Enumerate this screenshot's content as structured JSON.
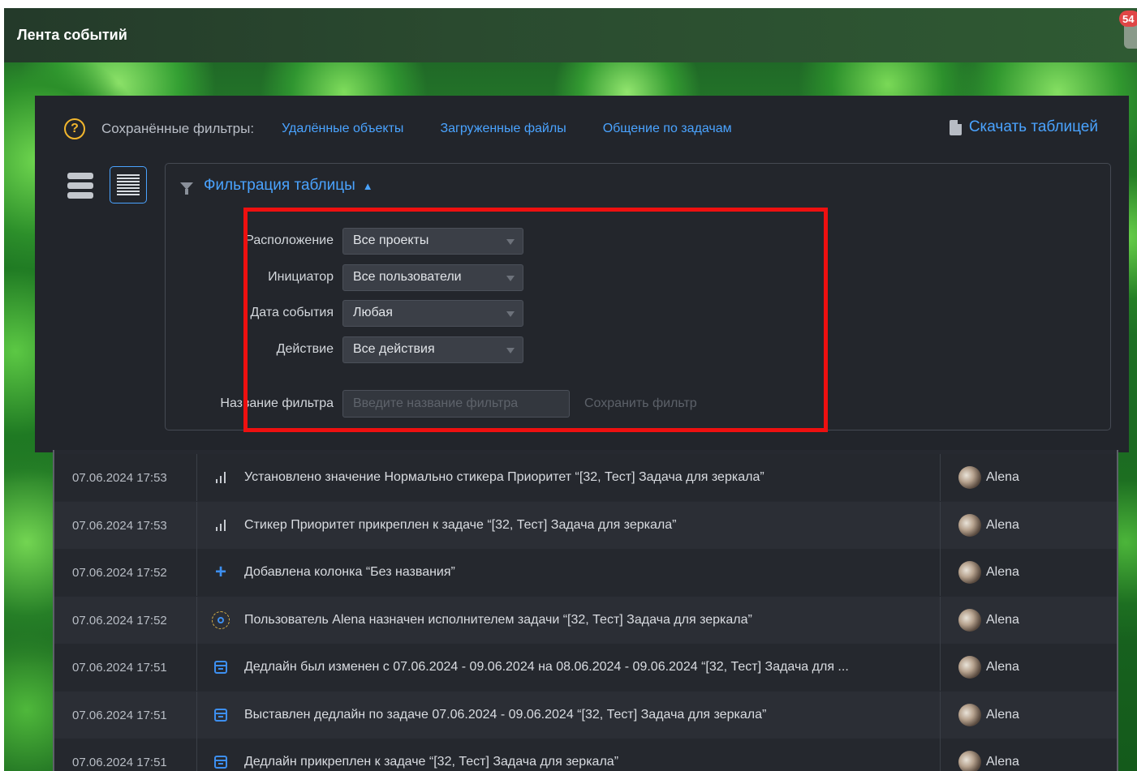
{
  "header": {
    "title": "Лента событий",
    "notification_count": "54"
  },
  "saved_filters": {
    "label": "Сохранённые фильтры:",
    "links": [
      "Удалённые объекты",
      "Загруженные файлы",
      "Общение по задачам"
    ],
    "download_label": "Скачать таблицей"
  },
  "filter": {
    "title": "Фильтрация таблицы",
    "fields": [
      {
        "label": "Расположение",
        "value": "Все проекты"
      },
      {
        "label": "Инициатор",
        "value": "Все пользователи"
      },
      {
        "label": "Дата события",
        "value": "Любая"
      },
      {
        "label": "Действие",
        "value": "Все действия"
      }
    ],
    "name_label": "Название фильтра",
    "name_placeholder": "Введите название фильтра",
    "save_label": "Сохранить фильтр"
  },
  "events": [
    {
      "date": "07.06.2024 17:53",
      "icon": "bars-icon",
      "text": "Установлено значение Нормально стикера Приоритет “[32, Тест] Задача для зеркала”",
      "user": "Alena"
    },
    {
      "date": "07.06.2024 17:53",
      "icon": "bars-icon",
      "text": "Стикер Приоритет прикреплен к задаче “[32, Тест] Задача для зеркала”",
      "user": "Alena"
    },
    {
      "date": "07.06.2024 17:52",
      "icon": "plus-icon",
      "text": "Добавлена колонка “Без названия”",
      "user": "Alena"
    },
    {
      "date": "07.06.2024 17:52",
      "icon": "user-icon",
      "text": "Пользователь Alena назначен исполнителем задачи “[32, Тест] Задача для зеркала”",
      "user": "Alena"
    },
    {
      "date": "07.06.2024 17:51",
      "icon": "calendar-icon",
      "text": "Дедлайн был изменен с 07.06.2024 - 09.06.2024 на 08.06.2024 - 09.06.2024 “[32, Тест] Задача для ...",
      "user": "Alena"
    },
    {
      "date": "07.06.2024 17:51",
      "icon": "calendar-icon",
      "text": "Выставлен дедлайн по задаче 07.06.2024 - 09.06.2024 “[32, Тест] Задача для зеркала”",
      "user": "Alena"
    },
    {
      "date": "07.06.2024 17:51",
      "icon": "calendar-icon",
      "text": "Дедлайн прикреплен к задаче “[32, Тест] Задача для зеркала”",
      "user": "Alena"
    }
  ],
  "colors": {
    "accent": "#4aa3ff",
    "highlight": "#ee1010",
    "help": "#f2b62d"
  }
}
